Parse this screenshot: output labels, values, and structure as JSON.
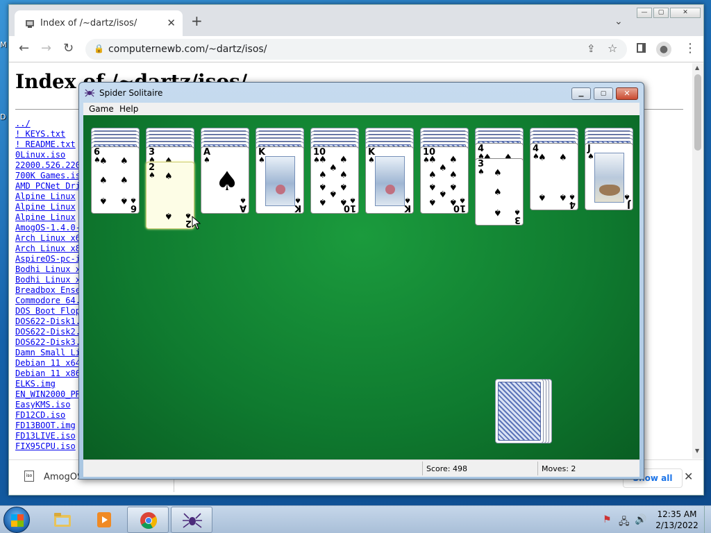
{
  "desktop": {
    "icons": [
      "M",
      "D"
    ]
  },
  "browser": {
    "tab": {
      "title": "Index of /~dartz/isos/"
    },
    "address": {
      "url": "computernewb.com/~dartz/isos/"
    },
    "page": {
      "title": "Index of /~dartz/isos/",
      "files": [
        "../",
        "! KEYS.txt",
        "! README.txt",
        "0Linux.iso",
        "22000.526.220",
        "700K Games.is",
        "AMD PCNet Dri",
        "Alpine Linux",
        "Alpine Linux",
        "Alpine Linux",
        "AmogOS-1.4.0-",
        "Arch Linux x6",
        "Arch Linux x8",
        "AspireOS-pc-i",
        "Bodhi Linux x",
        "Bodhi Linux x",
        "Breadbox Ense",
        "Commodore 64.",
        "DOS Boot Flop",
        "DOS622-Disk1.",
        "DOS622-Disk2.",
        "DOS622-Disk3.",
        "Damn Small Li",
        "Debian 11 x64",
        "Debian 11 x86",
        "ELKS.img",
        "EN_WIN2000_PR",
        "EasyKMS.iso",
        "FD12CD.iso",
        "FD13BOOT.img",
        "FD13LIVE.iso",
        "FIX95CPU.iso"
      ]
    },
    "download": {
      "file": "AmogOS",
      "show_all": "Show all"
    }
  },
  "solitaire": {
    "title": "Spider Solitaire",
    "menu": [
      "Game",
      "Help"
    ],
    "status": {
      "score": "Score: 498",
      "moves": "Moves:   2"
    },
    "columns": [
      {
        "backs": 5,
        "cards": [
          {
            "rank": "6",
            "big": false
          }
        ]
      },
      {
        "backs": 5,
        "cards": [
          {
            "rank": "3",
            "big": false
          },
          {
            "rank": "2",
            "big": false,
            "highlight": true
          }
        ]
      },
      {
        "backs": 5,
        "cards": [
          {
            "rank": "A",
            "big": true
          }
        ]
      },
      {
        "backs": 5,
        "cards": [
          {
            "rank": "K",
            "face": "k"
          }
        ]
      },
      {
        "backs": 5,
        "cards": [
          {
            "rank": "10",
            "big": false
          }
        ]
      },
      {
        "backs": 5,
        "cards": [
          {
            "rank": "K",
            "face": "k"
          }
        ]
      },
      {
        "backs": 5,
        "cards": [
          {
            "rank": "10",
            "big": false
          }
        ]
      },
      {
        "backs": 4,
        "cards": [
          {
            "rank": "4",
            "big": false
          },
          {
            "rank": "3",
            "big": false
          }
        ]
      },
      {
        "backs": 4,
        "cards": [
          {
            "rank": "4",
            "big": false
          }
        ]
      },
      {
        "backs": 4,
        "cards": [
          {
            "rank": "J",
            "face": "j"
          }
        ]
      }
    ],
    "stock_piles": 4,
    "suit_symbol": "♠"
  },
  "taskbar": {
    "time": "12:35 AM",
    "date": "2/13/2022"
  }
}
